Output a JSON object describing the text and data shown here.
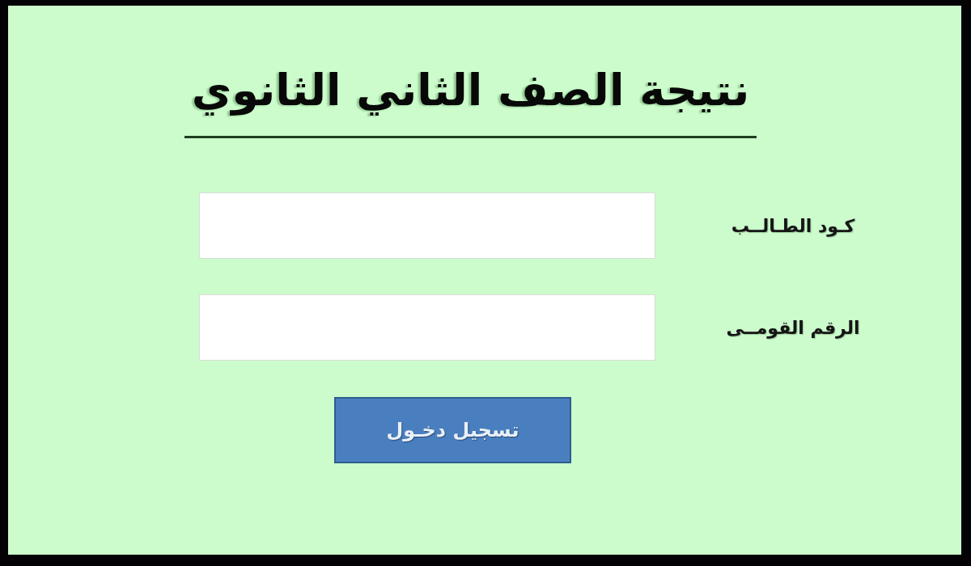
{
  "title": "نتيجة الصف الثاني الثانوي",
  "fields": [
    {
      "label": "كـود الطـالــب"
    },
    {
      "label": "الرقم القومــى"
    }
  ],
  "button": {
    "label": "تسجيل دخـول"
  }
}
